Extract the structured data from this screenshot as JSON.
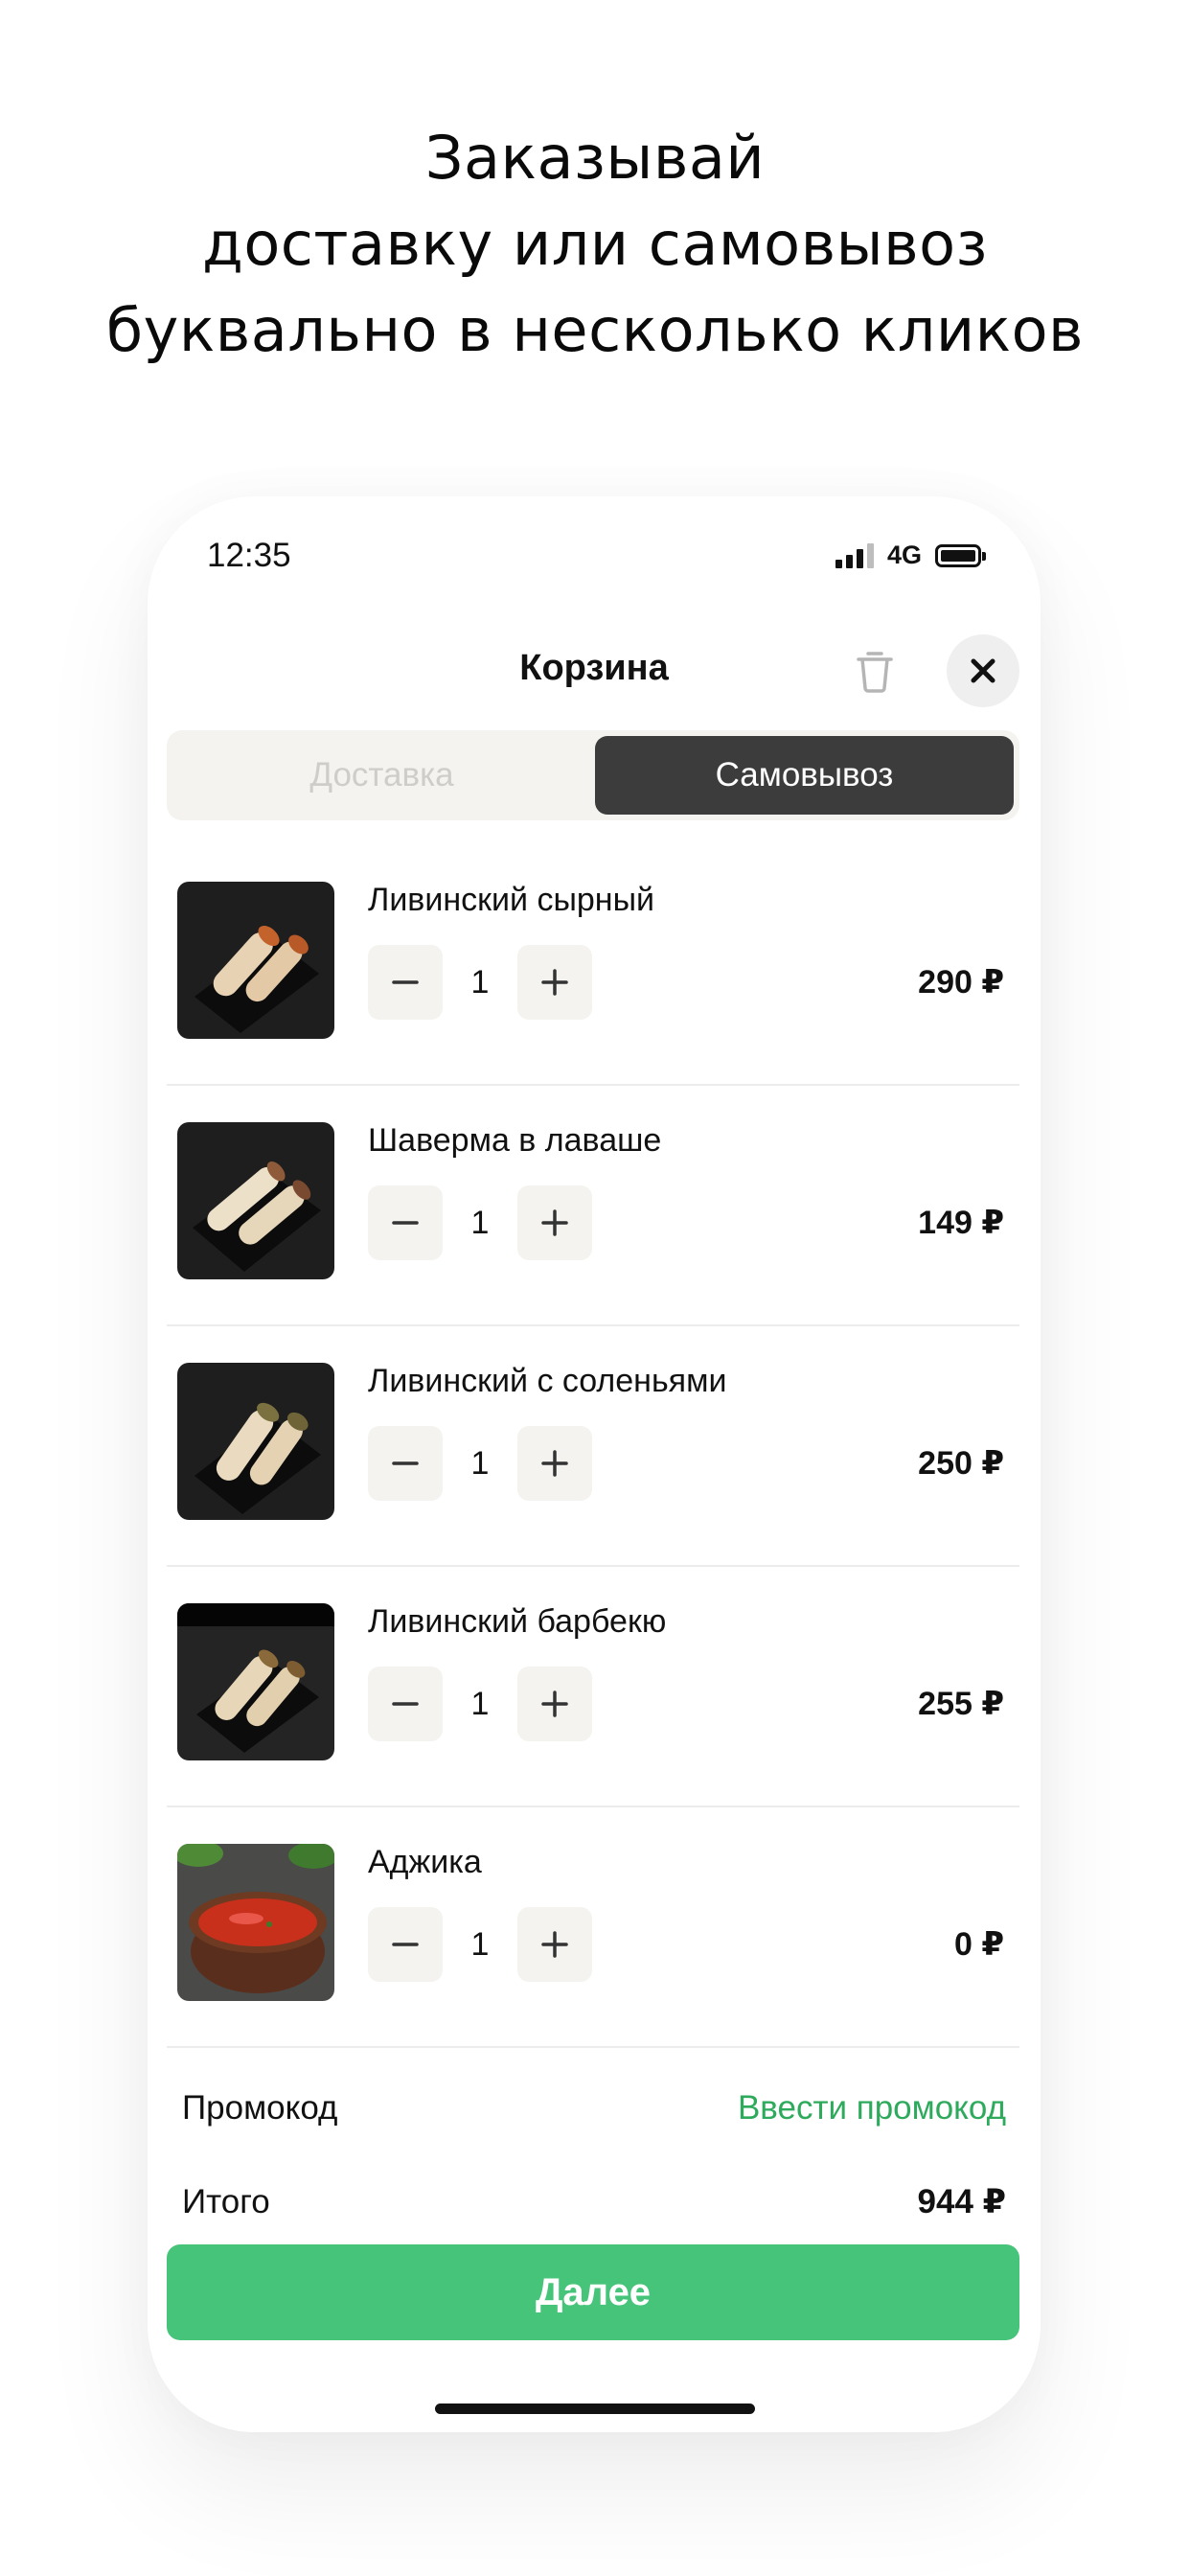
{
  "headline": {
    "lines": [
      "Заказывай",
      "доставку или самовывоз",
      "буквально в несколько кликов"
    ]
  },
  "status_bar": {
    "time": "12:35",
    "network": "4G"
  },
  "header": {
    "title": "Корзина"
  },
  "tabs": [
    {
      "label": "Доставка",
      "selected": false
    },
    {
      "label": "Самовывоз",
      "selected": true
    }
  ],
  "items": [
    {
      "name": "Ливинский сырный",
      "qty": "1",
      "price": "290 ₽"
    },
    {
      "name": "Шаверма в лаваше",
      "qty": "1",
      "price": "149 ₽"
    },
    {
      "name": "Ливинский с соленьями",
      "qty": "1",
      "price": "250 ₽"
    },
    {
      "name": "Ливинский барбекю",
      "qty": "1",
      "price": "255 ₽"
    },
    {
      "name": "Аджика",
      "qty": "1",
      "price": "0 ₽"
    }
  ],
  "promo": {
    "label": "Промокод",
    "link": "Ввести промокод"
  },
  "total": {
    "label": "Итого",
    "value": "944 ₽"
  },
  "next_button": {
    "label": "Далее"
  },
  "colors": {
    "accent_green": "#46c479",
    "link_green": "#2eaa5c",
    "segment_bg": "#f4f3ef",
    "segment_selected": "#3c3c3c"
  }
}
